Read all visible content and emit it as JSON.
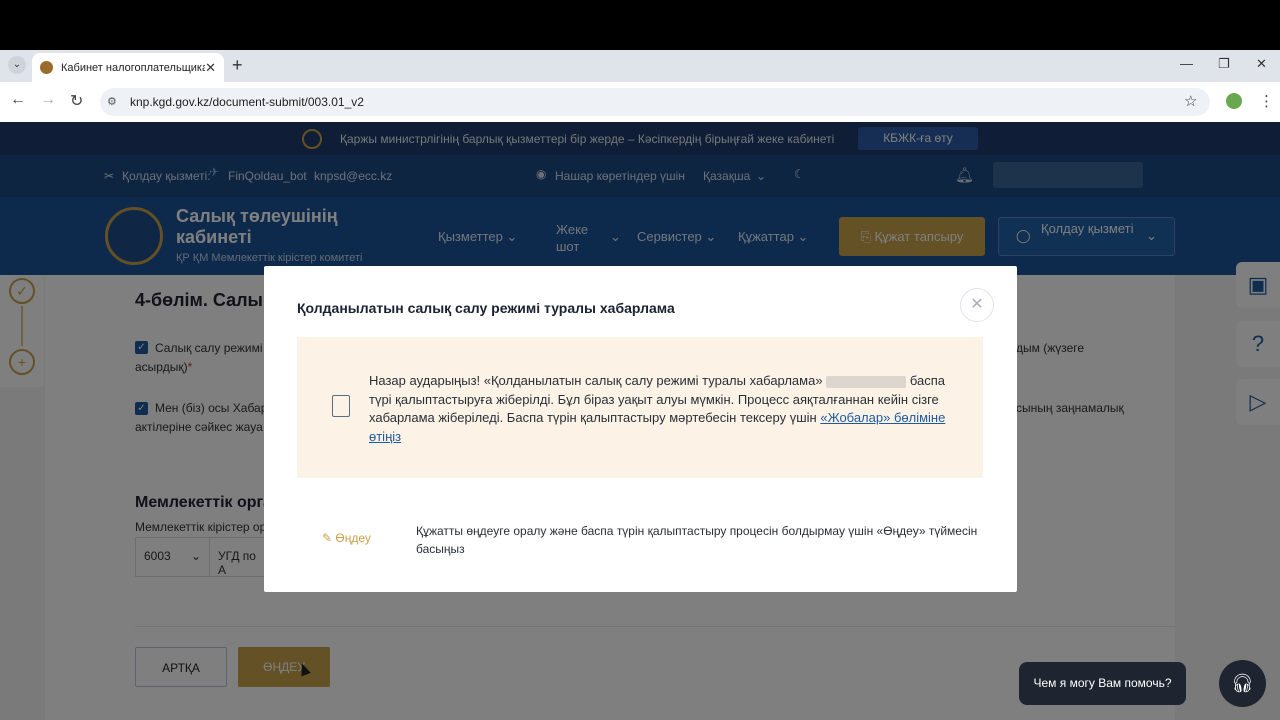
{
  "browser": {
    "tab_title": "Кабинет налогоплательщика",
    "tab_close": "✕",
    "new_tab": "+",
    "url": "knp.kgd.gov.kz/document-submit/003.01_v2"
  },
  "banner": {
    "text": "Қаржы министрлігінің барлық қызметтері бір жерде – Кәсіпкердің бірыңғай жеке кабинеті",
    "button": "КБЖК-ға өту"
  },
  "infobar": {
    "support_label": "Қолдау қызметі:",
    "telegram": "FinQoldau_bot",
    "email": "knpsd@ecc.kz",
    "low_vision": "Нашар көретіндер үшін",
    "language": "Қазақша"
  },
  "nav": {
    "brand_title": "Салық төлеушінің кабинеті",
    "brand_subtitle": "ҚР ҚМ Мемлекеттік кірістер комитеті",
    "items": [
      "Қызметтер",
      "Жеке шот",
      "Сервистер",
      "Құжаттар"
    ],
    "submit": "Құжат тапсыру",
    "support": "Қолдау қызметі"
  },
  "form": {
    "section_title": "4-бөлім. Салы",
    "check1_a": "Салық салу режимі",
    "check1_b": "асырдық)",
    "check1_tail": "дым (жүзеге",
    "check2_a": "Мен (біз) осы Хабар",
    "check2_b": "актілеріне сәйкес жауа",
    "check2_tail": "сының заңнамалық",
    "org_title": "Мемлекеттік орга",
    "org_label": "Мемлекеттік кірістер ор",
    "org_code": "6003",
    "org_name": "УГД по А",
    "back": "АРТҚА",
    "edit": "ӨҢДЕУ"
  },
  "modal": {
    "title": "Қолданылатын салық салу режимі туралы хабарлама",
    "notice_prefix": "Назар аударыңыз! «Қолданылатын салық салу режимі туралы хабарлама»",
    "notice_body": "баспа түрі қалыптастыруға жіберілді. Бұл біраз уақыт алуы мүмкін. Процесс аяқталғаннан кейін сізге хабарлама жіберіледі. Баспа түрін қалыптастыру мәртебесін тексеру үшін",
    "notice_link": "«Жобалар» бөліміне өтіңіз",
    "edit_link": "Өңдеу",
    "edit_text": "Құжатты өңдеуге оралу және баспа түрін қалыптастыру процесін болдырмау үшін «Өңдеу» түймесін басыңыз"
  },
  "chat": {
    "prompt": "Чем я могу Вам помочь?"
  }
}
